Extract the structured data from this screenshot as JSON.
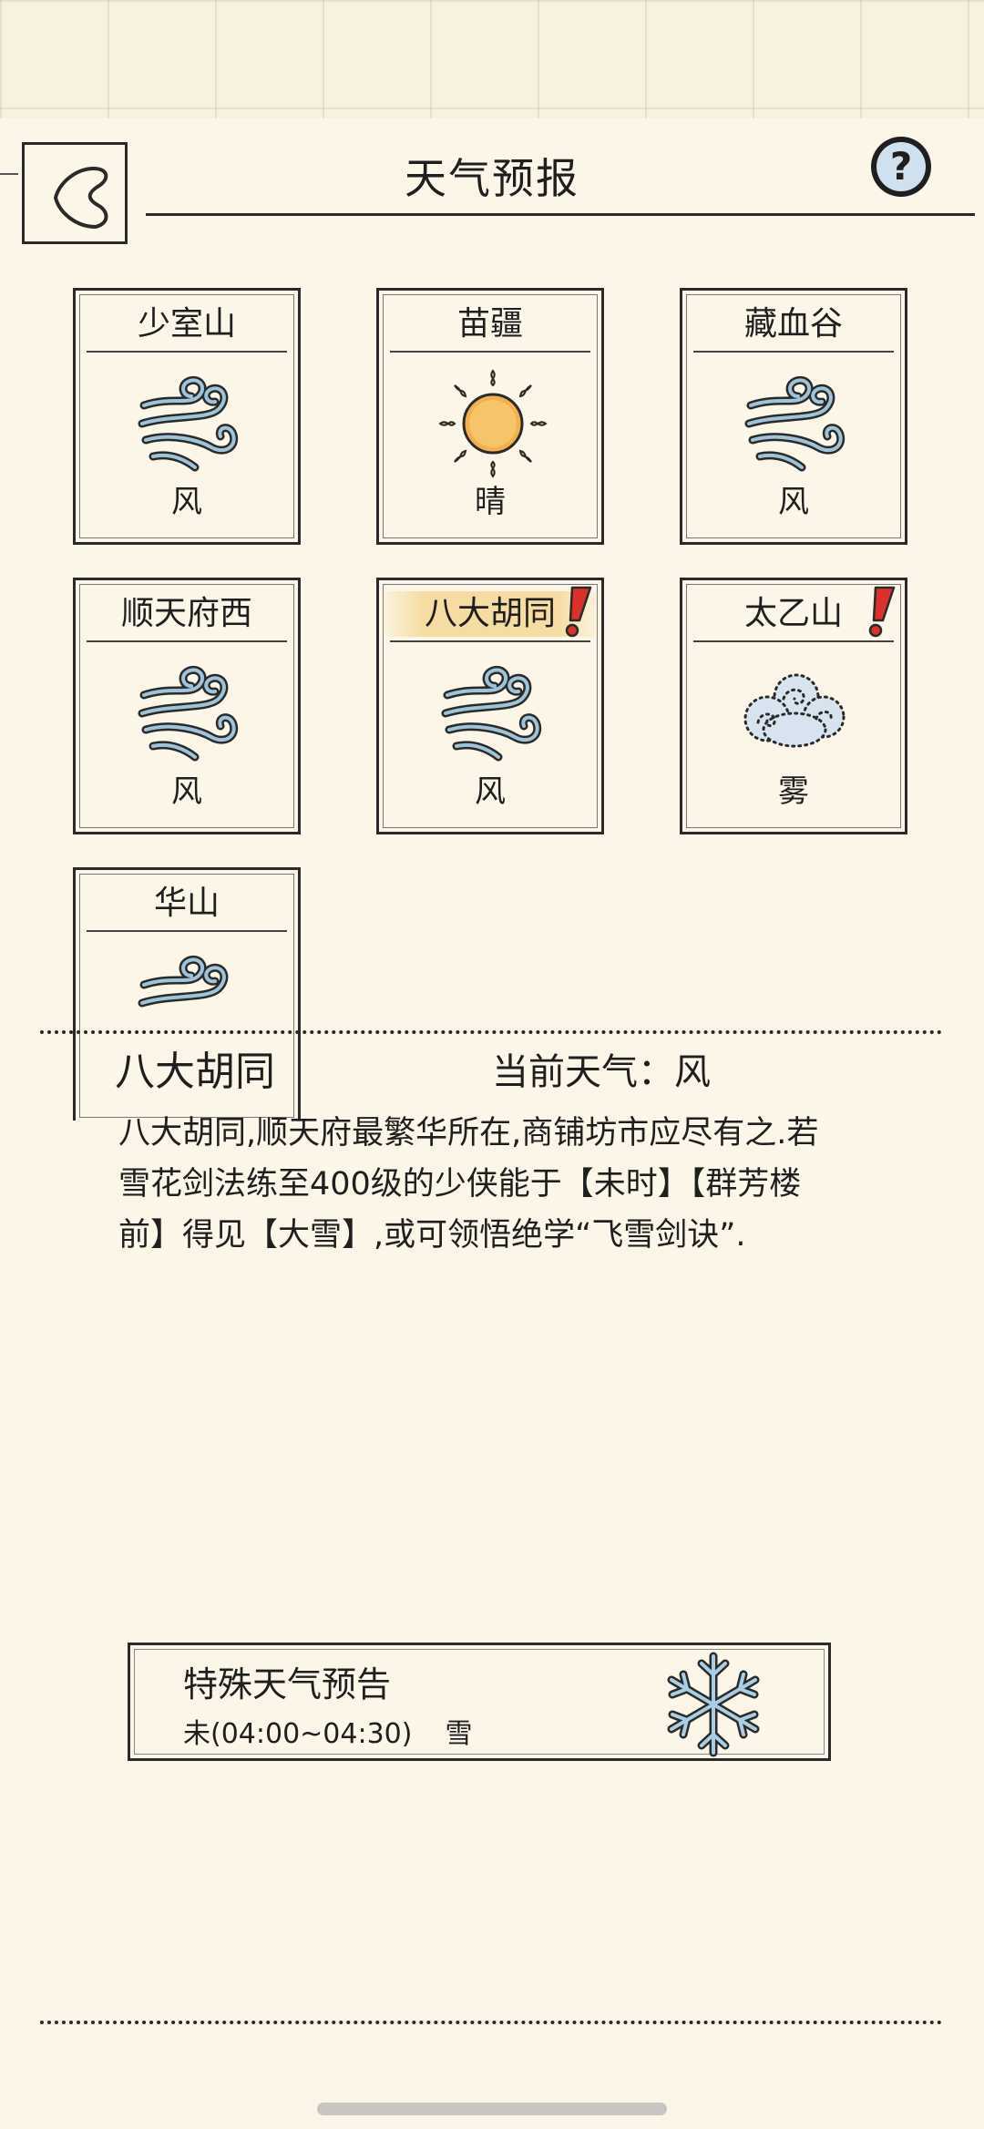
{
  "header": {
    "title": "天气预报",
    "help_label": "?"
  },
  "regions": [
    {
      "name": "少室山",
      "weather": "风",
      "icon": "wind-icon",
      "alert": false,
      "highlight": false
    },
    {
      "name": "苗疆",
      "weather": "晴",
      "icon": "sun-icon",
      "alert": false,
      "highlight": false
    },
    {
      "name": "藏血谷",
      "weather": "风",
      "icon": "wind-icon",
      "alert": false,
      "highlight": false
    },
    {
      "name": "顺天府西",
      "weather": "风",
      "icon": "wind-icon",
      "alert": false,
      "highlight": false
    },
    {
      "name": "八大胡同",
      "weather": "风",
      "icon": "wind-icon",
      "alert": true,
      "highlight": true
    },
    {
      "name": "太乙山",
      "weather": "雾",
      "icon": "fog-icon",
      "alert": true,
      "highlight": false
    },
    {
      "name": "华山",
      "weather": "",
      "icon": "wind-icon",
      "alert": false,
      "highlight": false
    }
  ],
  "detail": {
    "location": "八大胡同",
    "current_weather": "当前天气：风",
    "description": "八大胡同,顺天府最繁华所在,商铺坊市应尽有之.若雪花剑法练至400级的少侠能于【未时】【群芳楼前】得见【大雪】,或可领悟绝学“飞雪剑诀”."
  },
  "special_forecast": {
    "title": "特殊天气预告",
    "time": "未(04:00~04:30)",
    "weather": "雪",
    "icon": "snowflake-icon"
  },
  "colors": {
    "background": "#fbf6e7",
    "highlight": "#f5d796",
    "alert": "#d9312b",
    "icon_blue": "#9fc3d8"
  }
}
